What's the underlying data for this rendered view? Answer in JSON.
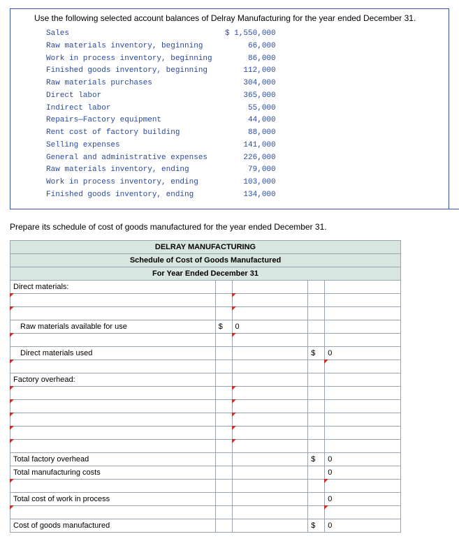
{
  "intro": "Use the following selected account balances of Delray Manufacturing for the year ended December 31.",
  "balances": [
    {
      "label": "Sales",
      "amount": "$ 1,550,000"
    },
    {
      "label": "Raw materials inventory, beginning",
      "amount": "66,000"
    },
    {
      "label": "Work in process inventory, beginning",
      "amount": "86,000"
    },
    {
      "label": "Finished goods inventory, beginning",
      "amount": "112,000"
    },
    {
      "label": "Raw materials purchases",
      "amount": "304,000"
    },
    {
      "label": "Direct labor",
      "amount": "365,000"
    },
    {
      "label": "Indirect labor",
      "amount": "55,000"
    },
    {
      "label": "Repairs—Factory equipment",
      "amount": "44,000"
    },
    {
      "label": "Rent cost of factory building",
      "amount": "88,000"
    },
    {
      "label": "Selling expenses",
      "amount": "141,000"
    },
    {
      "label": "General and administrative expenses",
      "amount": "226,000"
    },
    {
      "label": "Raw materials inventory, ending",
      "amount": "79,000"
    },
    {
      "label": "Work in process inventory, ending",
      "amount": "103,000"
    },
    {
      "label": "Finished goods inventory, ending",
      "amount": "134,000"
    }
  ],
  "instruction": "Prepare its schedule of cost of goods manufactured for the year ended December 31.",
  "sched": {
    "title1": "DELRAY MANUFACTURING",
    "title2": "Schedule of Cost of Goods Manufactured",
    "title3": "For Year Ended December 31",
    "rows": {
      "direct_materials": "Direct materials:",
      "rm_avail": "Raw materials available for use",
      "dm_used": "Direct materials used",
      "factory_oh": "Factory overhead:",
      "total_foh": "Total factory overhead",
      "total_mfg": "Total manufacturing costs",
      "total_wip": "Total cost of work in process",
      "cogm": "Cost of goods manufactured"
    },
    "vals": {
      "dollar": "$",
      "zero": "0"
    }
  }
}
